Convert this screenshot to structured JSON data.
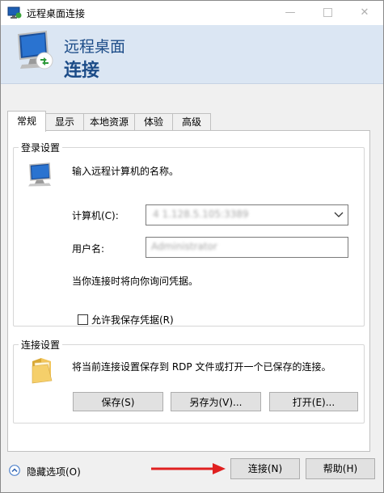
{
  "window": {
    "title": "远程桌面连接",
    "minimize_glyph": "—",
    "close_glyph": "✕"
  },
  "banner": {
    "line1": "远程桌面",
    "line2": "连接"
  },
  "tabs": [
    {
      "label": "常规",
      "active": true
    },
    {
      "label": "显示",
      "active": false
    },
    {
      "label": "本地资源",
      "active": false
    },
    {
      "label": "体验",
      "active": false
    },
    {
      "label": "高级",
      "active": false
    }
  ],
  "login": {
    "group_title": "登录设置",
    "instruction": "输入远程计算机的名称。",
    "computer_label": "计算机(C):",
    "computer_value": "4 1.128.5.105:3389",
    "username_label": "用户名:",
    "username_value": "Administrator",
    "note": "当你连接时将向你询问凭据。",
    "save_credentials_label": "允许我保存凭据(R)",
    "save_credentials_checked": false
  },
  "connection": {
    "group_title": "连接设置",
    "description": "将当前连接设置保存到 RDP 文件或打开一个已保存的连接。",
    "save_button": "保存(S)",
    "save_as_button": "另存为(V)...",
    "open_button": "打开(E)..."
  },
  "footer": {
    "hide_options": "隐藏选项(O)",
    "connect_button": "连接(N)",
    "help_button": "帮助(H)"
  },
  "colors": {
    "banner_bg": "#dbe6f3",
    "banner_text": "#1c4c88",
    "annotation_arrow": "#e02020"
  },
  "icons": {
    "app": "remote-desktop-icon",
    "banner": "remote-desktop-monitor-icon",
    "login": "computer-icon",
    "connection": "folder-icon",
    "hide_options": "chevron-up-circle-icon"
  }
}
